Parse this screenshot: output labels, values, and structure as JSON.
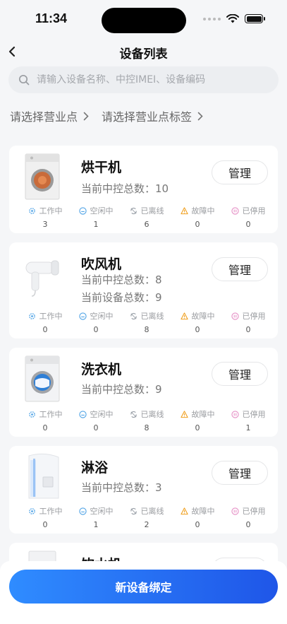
{
  "status_bar": {
    "time": "11:34"
  },
  "nav": {
    "title": "设备列表"
  },
  "search": {
    "placeholder": "请输入设备名称、中控IMEI、设备编码",
    "value": ""
  },
  "filters": [
    {
      "label": "请选择营业点"
    },
    {
      "label": "请选择营业点标签"
    }
  ],
  "stat_labels": [
    "工作中",
    "空闲中",
    "已离线",
    "故障中",
    "已停用"
  ],
  "colors": {
    "working": "#4fa3e6",
    "idle": "#4fa3e6",
    "offline": "#9aa0a8",
    "fault": "#f0a020",
    "stopped": "#e58fc5",
    "accent": "#2f6ff0"
  },
  "devices": [
    {
      "name": "烘干机",
      "image": "dryer",
      "metrics": [
        "当前中控总数：10"
      ],
      "counts": [
        "3",
        "1",
        "6",
        "0",
        "0"
      ],
      "manage_label": "管理"
    },
    {
      "name": "吹风机",
      "image": "hair-dryer",
      "metrics": [
        "当前中控总数：8",
        "当前设备总数：9"
      ],
      "counts": [
        "0",
        "0",
        "8",
        "0",
        "0"
      ],
      "manage_label": "管理"
    },
    {
      "name": "洗衣机",
      "image": "washing-machine",
      "metrics": [
        "当前中控总数：9"
      ],
      "counts": [
        "0",
        "0",
        "8",
        "0",
        "1"
      ],
      "manage_label": "管理"
    },
    {
      "name": "淋浴",
      "image": "shower",
      "metrics": [
        "当前中控总数：3"
      ],
      "counts": [
        "0",
        "1",
        "2",
        "0",
        "0"
      ],
      "manage_label": "管理"
    },
    {
      "name": "饮水机",
      "image": "water-dispenser",
      "metrics": [],
      "counts": [],
      "manage_label": "管理"
    }
  ],
  "bottom": {
    "bind_label": "新设备绑定"
  }
}
